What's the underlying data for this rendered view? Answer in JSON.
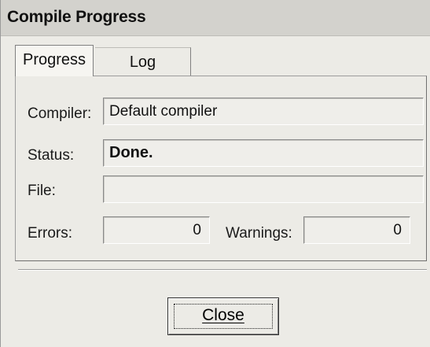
{
  "window": {
    "title": "Compile Progress"
  },
  "tabs": [
    {
      "label": "Progress",
      "selected": true
    },
    {
      "label": "Log",
      "selected": false
    }
  ],
  "progress": {
    "compiler_label": "Compiler:",
    "compiler_value": "Default compiler",
    "status_label": "Status:",
    "status_value": "Done.",
    "file_label": "File:",
    "file_value": "",
    "errors_label": "Errors:",
    "errors_value": "0",
    "warnings_label": "Warnings:",
    "warnings_value": "0"
  },
  "buttons": {
    "close_label": "Close"
  }
}
